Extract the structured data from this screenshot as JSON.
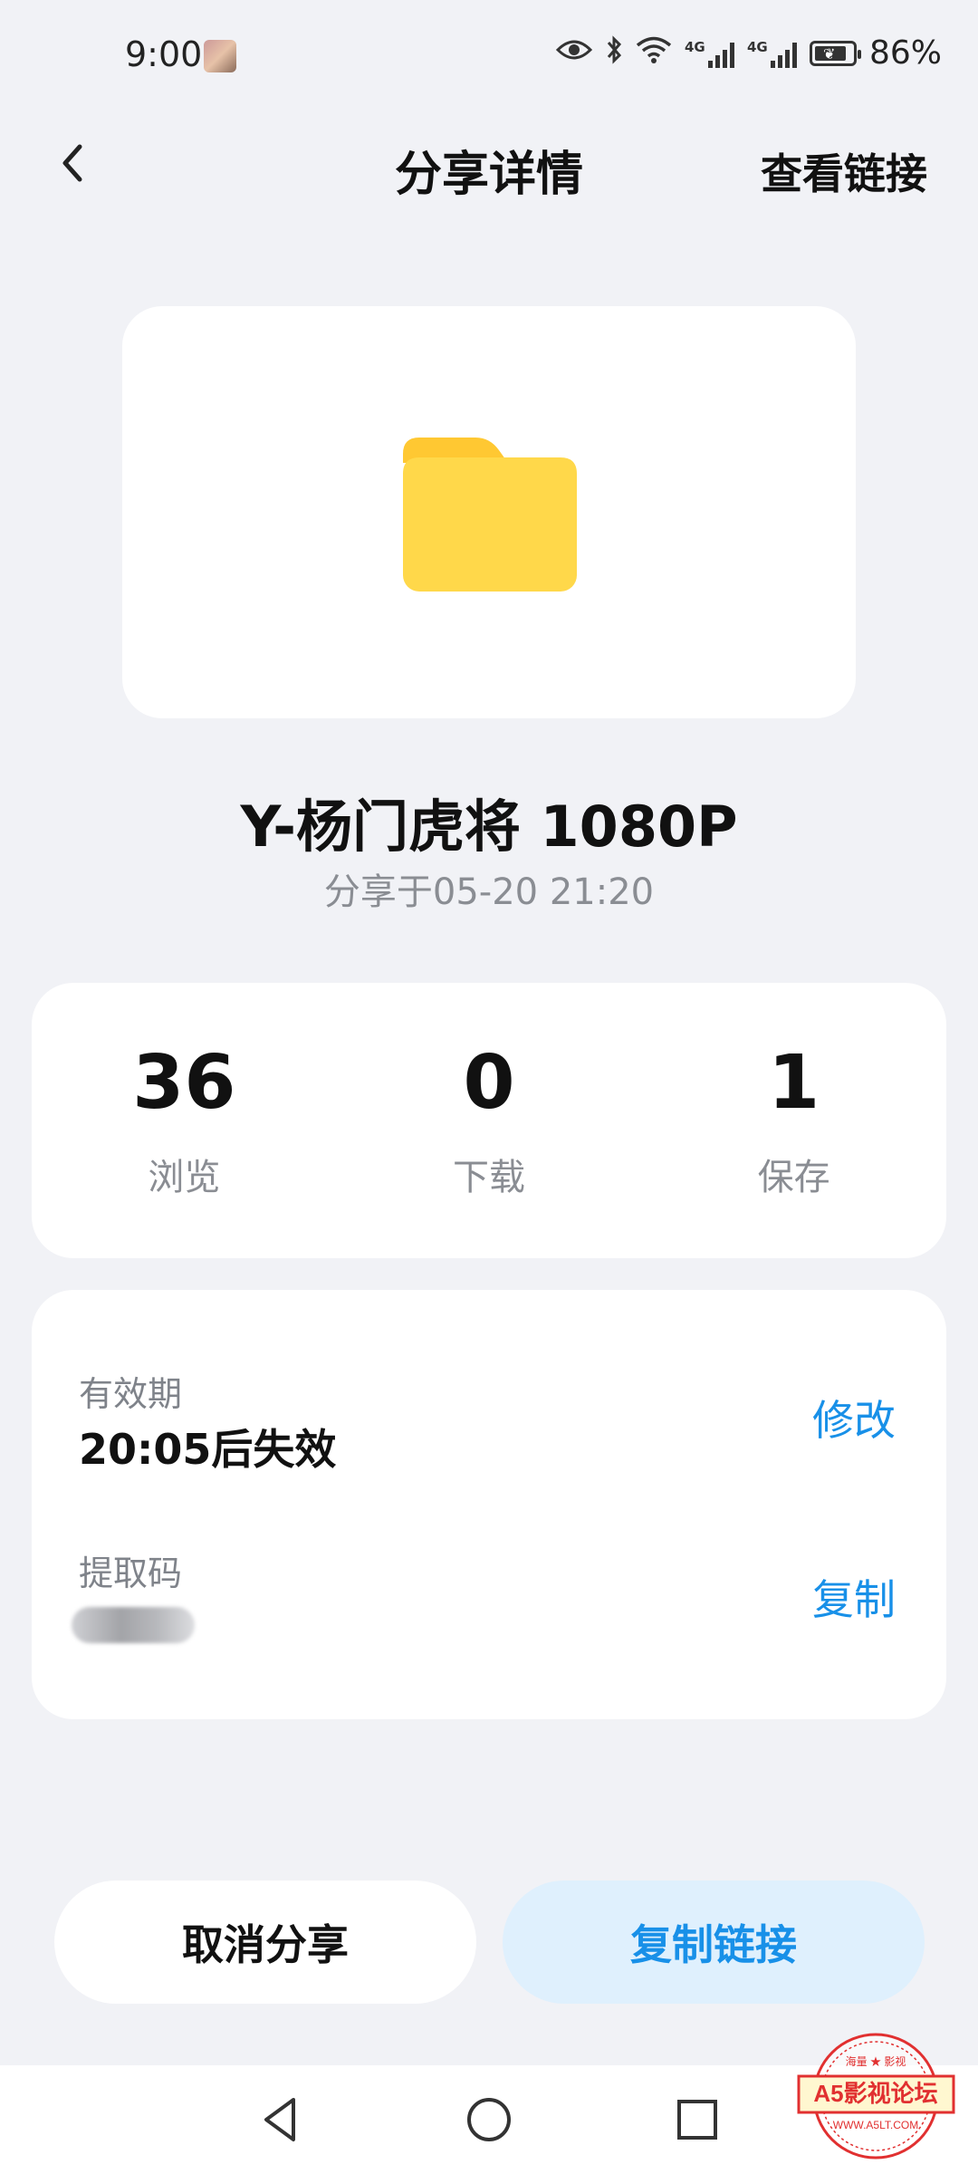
{
  "status_bar": {
    "time": "9:00",
    "icons": [
      "avatar-icon",
      "eye-icon",
      "bluetooth-icon",
      "wifi-icon",
      "signal-4g-icon",
      "signal-4g-icon",
      "battery-icon"
    ],
    "network_tag": "4G",
    "battery_percent_text": "86%",
    "battery_level": 0.86
  },
  "header": {
    "back_icon": "chevron-left-icon",
    "title": "分享详情",
    "view_link_label": "查看链接"
  },
  "file": {
    "icon": "folder-icon",
    "name": "Y-杨门虎将 1080P",
    "shared_at": "分享于05-20 21:20"
  },
  "stats": [
    {
      "value": "36",
      "label": "浏览"
    },
    {
      "value": "0",
      "label": "下载"
    },
    {
      "value": "1",
      "label": "保存"
    }
  ],
  "details": {
    "validity_label": "有效期",
    "validity_value": "20:05后失效",
    "modify_label": "修改",
    "code_label": "提取码",
    "copy_label": "复制"
  },
  "actions": {
    "cancel_label": "取消分享",
    "copy_link_label": "复制链接"
  },
  "nav": {
    "icons": [
      "nav-back-icon",
      "nav-home-icon",
      "nav-recent-icon"
    ]
  },
  "watermark": {
    "text": "A5影视论坛",
    "url": "WWW.A5LT.COM",
    "top_text": "海量 ★ 影视"
  },
  "colors": {
    "background": "#f1f2f6",
    "accent": "#1890e8",
    "accent_bg": "#dff0fd",
    "folder": "#ffd84a"
  }
}
